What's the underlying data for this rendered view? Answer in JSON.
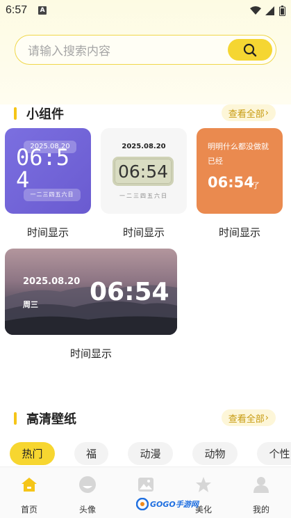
{
  "status_bar": {
    "time": "6:57",
    "a_label": "A"
  },
  "search": {
    "placeholder": "请输入搜索内容"
  },
  "widgets_section": {
    "title": "小组件",
    "more": "查看全部"
  },
  "widgets": [
    {
      "label": "时间显示",
      "date": "2025.08.20",
      "time_text": "06:54",
      "week": "一二三四五六日"
    },
    {
      "label": "时间显示",
      "date": "2025.08.20",
      "time_text": "06:54",
      "week": "一二三四五六日"
    },
    {
      "label": "时间显示",
      "message": "明明什么都没做就已经",
      "time_text": "06:54",
      "suffix": "了"
    },
    {
      "label": "时间显示",
      "date": "2025.08.20",
      "weekday": "周三",
      "time_text": "06:54"
    }
  ],
  "wallpaper_section": {
    "title": "高清壁纸",
    "more": "查看全部"
  },
  "categories": [
    "热门",
    "福",
    "动漫",
    "动物",
    "个性"
  ],
  "tabbar": {
    "items": [
      {
        "label": "首页",
        "icon": "home-icon",
        "active": true
      },
      {
        "label": "头像",
        "icon": "avatar-icon",
        "active": false
      },
      {
        "label": "",
        "icon": "image-icon",
        "active": false
      },
      {
        "label": "美化",
        "icon": "star-icon",
        "active": false
      },
      {
        "label": "我的",
        "icon": "user-icon",
        "active": false
      }
    ]
  },
  "watermark": {
    "text": "GOGO手游网"
  },
  "colors": {
    "accent": "#f5d632",
    "more_text": "#c79b10",
    "orange_card": "#ea8a4f",
    "purple_card": "#7b6fe0"
  }
}
